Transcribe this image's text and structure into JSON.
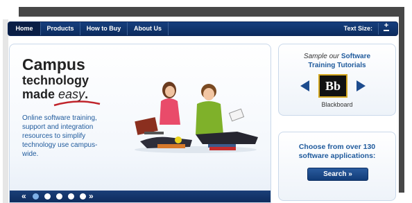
{
  "nav": {
    "items": [
      {
        "label": "Home",
        "active": true
      },
      {
        "label": "Products",
        "active": false
      },
      {
        "label": "How to Buy",
        "active": false
      },
      {
        "label": "About Us",
        "active": false
      }
    ],
    "text_size_label": "Text Size:",
    "increase_symbol": "+"
  },
  "hero": {
    "title_line1": "Campus",
    "title_line2": "technology",
    "title_line3_prefix": "made ",
    "title_line3_italic": "easy",
    "title_line3_suffix": ".",
    "description": "Online software training, support and integration resources to simplify technology use campus-wide.",
    "slider": {
      "prev": "«",
      "next": "»",
      "dot_count": 5,
      "active_index": 0
    }
  },
  "tutorials_card": {
    "line1_italic": "Sample our ",
    "line1_bold": "Software",
    "line2": "Training Tutorials",
    "logo_text": "Bb",
    "caption": "Blackboard"
  },
  "apps_card": {
    "text_line1": "Choose from over 130",
    "text_line2": "software applications:",
    "button_label": "Search »"
  },
  "colors": {
    "nav_bg": "#163f7e",
    "accent_blue": "#1f5a9c",
    "logo_gold": "#d4a71f"
  }
}
